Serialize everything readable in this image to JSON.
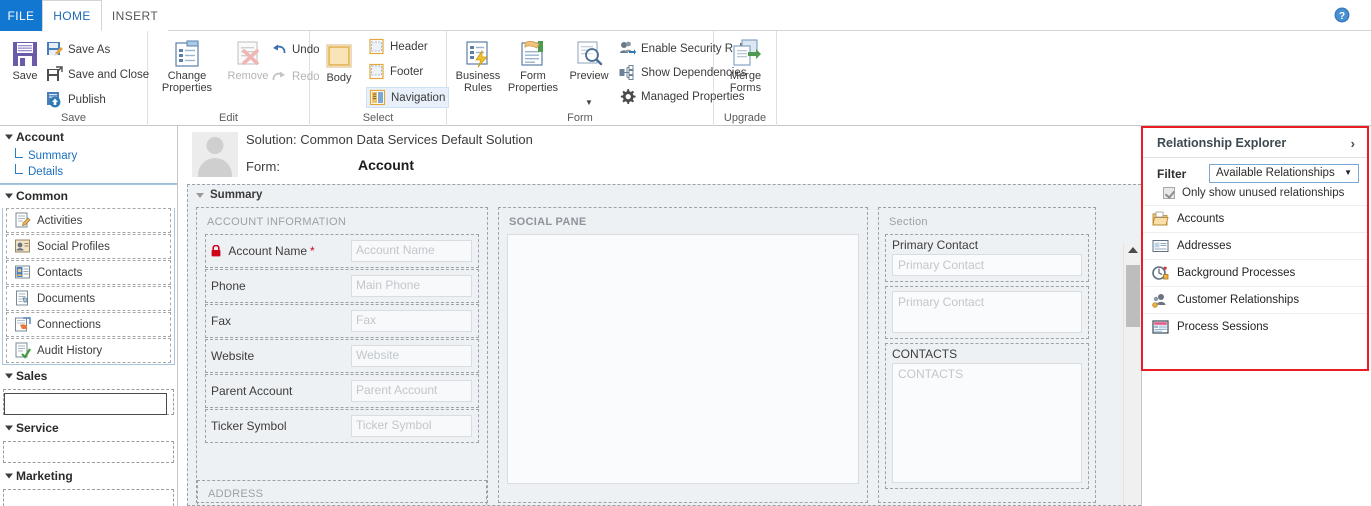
{
  "tabs": {
    "file": "FILE",
    "home": "HOME",
    "insert": "INSERT",
    "help_icon": "help-circle-icon"
  },
  "ribbon": {
    "groups": [
      {
        "label": "Save"
      },
      {
        "label": "Edit"
      },
      {
        "label": "Select"
      },
      {
        "label": "Form"
      },
      {
        "label": "Upgrade"
      }
    ],
    "save_group": {
      "save": "Save",
      "save_as": "Save As",
      "save_and_close": "Save and Close",
      "publish": "Publish"
    },
    "edit_group": {
      "change_properties": "Change\nProperties",
      "change_properties_line1": "Change",
      "change_properties_line2": "Properties",
      "remove": "Remove",
      "undo": "Undo",
      "redo": "Redo"
    },
    "select_group": {
      "body": "Body",
      "header": "Header",
      "footer": "Footer",
      "navigation": "Navigation"
    },
    "form_group": {
      "business_rules_line1": "Business",
      "business_rules_line2": "Rules",
      "form_properties_line1": "Form",
      "form_properties_line2": "Properties",
      "preview": "Preview",
      "enable_security_roles": "Enable Security Roles",
      "show_dependencies": "Show Dependencies",
      "managed_properties": "Managed Properties"
    },
    "upgrade_group": {
      "merge_forms_line1": "Merge",
      "merge_forms_line2": "Forms"
    }
  },
  "leftnav": {
    "account": {
      "title": "Account",
      "items": [
        "Summary",
        "Details"
      ]
    },
    "common": {
      "title": "Common",
      "items": [
        {
          "label": "Activities",
          "icon": "activities-icon"
        },
        {
          "label": "Social Profiles",
          "icon": "social-profiles-icon"
        },
        {
          "label": "Contacts",
          "icon": "contacts-icon"
        },
        {
          "label": "Documents",
          "icon": "documents-icon"
        },
        {
          "label": "Connections",
          "icon": "connections-icon"
        },
        {
          "label": "Audit History",
          "icon": "audit-history-icon"
        }
      ]
    },
    "sales": {
      "title": "Sales"
    },
    "service": {
      "title": "Service"
    },
    "marketing": {
      "title": "Marketing"
    }
  },
  "formheader": {
    "solution": "Solution: Common Data Services Default Solution",
    "form_label": "Form:",
    "form_value": "Account",
    "avatar": "account-avatar-icon"
  },
  "form": {
    "tab_title": "Summary",
    "account_information": {
      "section_title": "ACCOUNT INFORMATION",
      "fields": [
        {
          "label": "Account Name",
          "placeholder": "Account Name",
          "required": true,
          "locked": true
        },
        {
          "label": "Phone",
          "placeholder": "Main Phone",
          "required": false,
          "locked": false
        },
        {
          "label": "Fax",
          "placeholder": "Fax",
          "required": false,
          "locked": false
        },
        {
          "label": "Website",
          "placeholder": "Website",
          "required": false,
          "locked": false
        },
        {
          "label": "Parent Account",
          "placeholder": "Parent Account",
          "required": false,
          "locked": false
        },
        {
          "label": "Ticker Symbol",
          "placeholder": "Ticker Symbol",
          "required": false,
          "locked": false
        }
      ]
    },
    "address": {
      "section_title": "ADDRESS"
    },
    "social_pane": {
      "section_title": "SOCIAL PANE"
    },
    "right_column": {
      "section_title": "Section",
      "primary_contact_label": "Primary Contact",
      "primary_contact_placeholder": "Primary Contact",
      "primary_contact_block_placeholder": "Primary Contact",
      "contacts_label": "CONTACTS",
      "contacts_placeholder": "CONTACTS"
    }
  },
  "relationship_explorer": {
    "title": "Relationship Explorer",
    "expand_icon": "chevron-right-icon",
    "filter_label": "Filter",
    "filter_value": "Available Relationships",
    "checkbox_label": "Only show unused relationships",
    "checkbox_checked": true,
    "items": [
      {
        "label": "Accounts",
        "icon": "accounts-folder-icon"
      },
      {
        "label": "Addresses",
        "icon": "addresses-card-icon"
      },
      {
        "label": "Background Processes",
        "icon": "background-processes-icon"
      },
      {
        "label": "Customer Relationships",
        "icon": "customer-relationships-icon"
      },
      {
        "label": "Process Sessions",
        "icon": "process-sessions-icon"
      }
    ],
    "highlight_color": "#ec1c24"
  },
  "colors": {
    "accent_blue": "#1177d1",
    "link_blue": "#1b6fc0",
    "required_red": "#d0021b",
    "panel_bg": "#eef1f4"
  }
}
